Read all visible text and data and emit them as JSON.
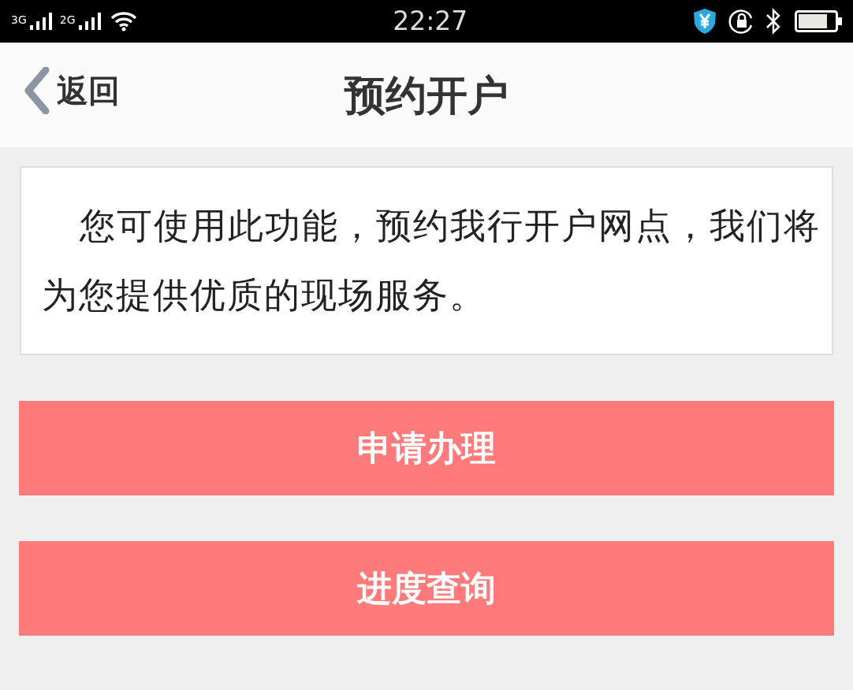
{
  "status_bar": {
    "network_1": "3G",
    "network_2": "2G",
    "time": "22:27"
  },
  "header": {
    "back": "返回",
    "title": "预约开户"
  },
  "intro": "您可使用此功能，预约我行开户网点，我们将为您提供优质的现场服务。",
  "buttons": [
    "申请办理",
    "进度查询"
  ]
}
